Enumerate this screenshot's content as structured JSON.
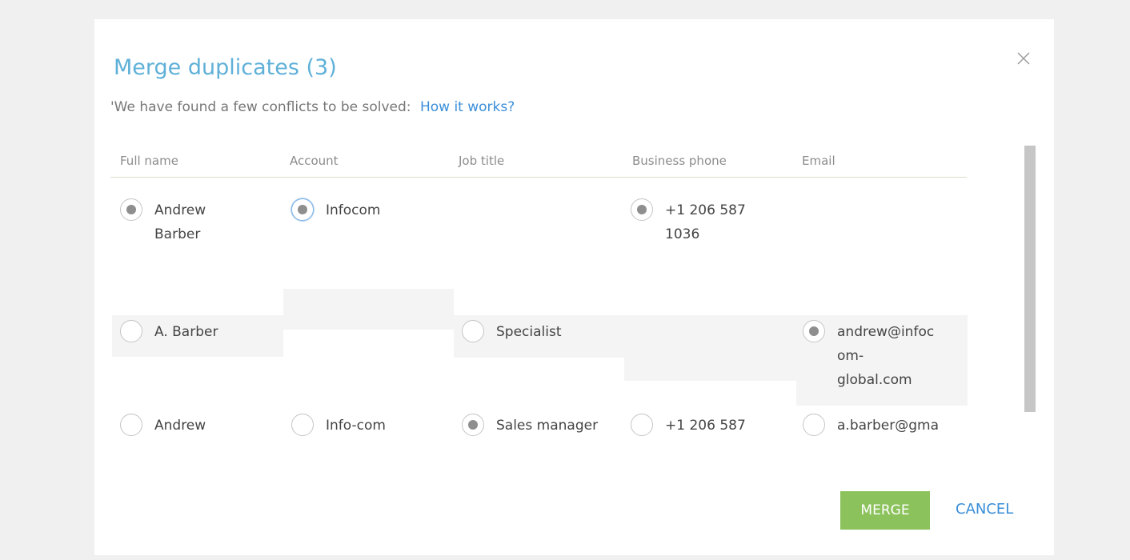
{
  "dialog": {
    "title": "Merge duplicates (3)",
    "subtitle": "'We have found a few conflicts to be solved:",
    "help_link": "How it works?"
  },
  "columns": [
    "Full name",
    "Account",
    "Job title",
    "Business phone",
    "Email"
  ],
  "rows": [
    {
      "full_name": {
        "label": "Andrew\nBarber",
        "checked": true
      },
      "account": {
        "label": "Infocom",
        "checked": true
      },
      "job_title": null,
      "business_phone": {
        "label": "+1 206 587\n1036",
        "checked": true
      },
      "email": null
    },
    {
      "full_name": {
        "label": "A. Barber",
        "checked": false
      },
      "account": null,
      "job_title": {
        "label": "Specialist",
        "checked": false
      },
      "business_phone": null,
      "email": {
        "label": "andrew@infoc\nom-\nglobal.com",
        "checked": true
      }
    },
    {
      "full_name": {
        "label": "Andrew",
        "checked": false
      },
      "account": {
        "label": "Info-com",
        "checked": false
      },
      "job_title": {
        "label": "Sales manager",
        "checked": true
      },
      "business_phone": {
        "label": "+1 206 587",
        "checked": false
      },
      "email": {
        "label": "a.barber@gma",
        "checked": false
      }
    }
  ],
  "buttons": {
    "merge": "MERGE",
    "cancel": "CANCEL"
  },
  "colors": {
    "title": "#5fb0d8",
    "link": "#3a8ed8",
    "merge_button": "#8cc25c"
  }
}
